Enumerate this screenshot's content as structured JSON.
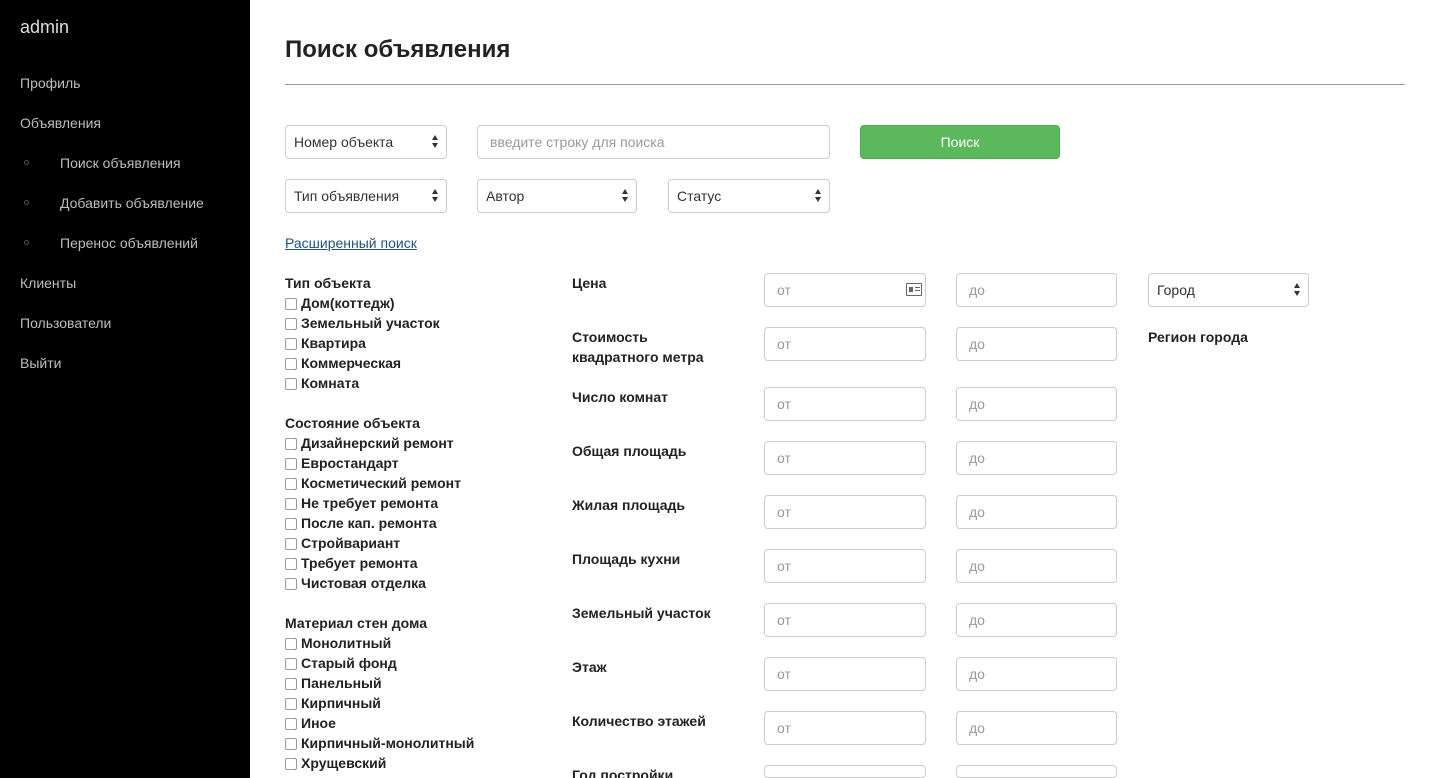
{
  "sidebar": {
    "brand": "admin",
    "items": [
      {
        "label": "Профиль"
      },
      {
        "label": "Объявления"
      },
      {
        "label": "Поиск объявления"
      },
      {
        "label": "Добавить объявление"
      },
      {
        "label": "Перенос объявлений"
      },
      {
        "label": "Клиенты"
      },
      {
        "label": "Пользователи"
      },
      {
        "label": "Выйти"
      }
    ]
  },
  "main": {
    "title": "Поиск объявления",
    "search_field_select": "Номер объекта",
    "search_placeholder": "введите строку для поиска",
    "search_button": "Поиск",
    "type_select": "Тип объявления",
    "author_select": "Автор",
    "status_select": "Статус",
    "advanced_link": "Расширенный поиск",
    "city_select": "Город",
    "region_label": "Регион города",
    "colors": {
      "search_button": "#5cb85c",
      "sidebar": "#000000",
      "link": "#23527c"
    }
  },
  "filters": {
    "object_type": {
      "title": "Тип объекта",
      "options": [
        "Дом(коттедж)",
        "Земельный участок",
        "Квартира",
        "Коммерческая",
        "Комната"
      ]
    },
    "condition": {
      "title": "Состояние объекта",
      "options": [
        "Дизайнерский ремонт",
        "Евростандарт",
        "Косметический ремонт",
        "Не требует ремонта",
        "После кап. ремонта",
        "Стройвариант",
        "Требует ремонта",
        "Чистовая отделка"
      ]
    },
    "wall_material": {
      "title": "Материал стен дома",
      "options": [
        "Монолитный",
        "Старый фонд",
        "Панельный",
        "Кирпичный",
        "Иное",
        "Кирпичный-монолитный",
        "Хрущевский"
      ]
    }
  },
  "ranges": {
    "from_placeholder": "от",
    "to_placeholder": "до",
    "labels": [
      "Цена",
      "Стоимость квадратного метра",
      "Число комнат",
      "Общая площадь",
      "Жилая площадь",
      "Площадь кухни",
      "Земельный участок",
      "Этаж",
      "Количество этажей",
      "Год постройки"
    ]
  }
}
